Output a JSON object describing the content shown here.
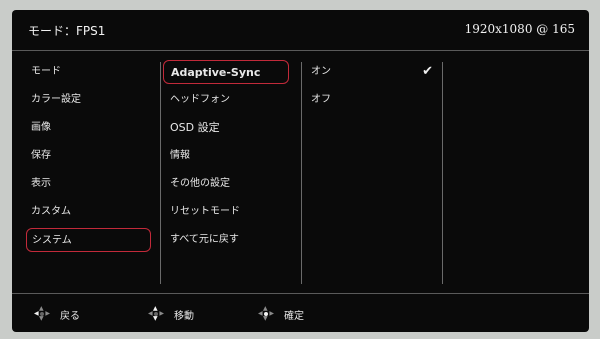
{
  "header": {
    "mode": "モード：FPS1",
    "resolution": "1920x1080 @ 165"
  },
  "main_menu": [
    {
      "label": "モード"
    },
    {
      "label": "カラー設定"
    },
    {
      "label": "画像"
    },
    {
      "label": "保存"
    },
    {
      "label": "表示"
    },
    {
      "label": "カスタム"
    },
    {
      "label": "システム",
      "selected": true
    }
  ],
  "sub_menu": [
    {
      "label": "Adaptive-Sync",
      "selected": true
    },
    {
      "label": "ヘッドフォン"
    },
    {
      "label": "OSD 設定"
    },
    {
      "label": "情報"
    },
    {
      "label": "その他の設定"
    },
    {
      "label": "リセットモード"
    },
    {
      "label": "すべて元に戻す"
    }
  ],
  "options": [
    {
      "label": "オン",
      "checked": true
    },
    {
      "label": "オフ",
      "checked": false
    }
  ],
  "footer": {
    "back_label": "戻る",
    "move_label": "移動",
    "confirm_label": "確定"
  },
  "colors": {
    "background": "#0a0a0a",
    "selection_border": "#c22a3a",
    "text": "#e8e8e8"
  },
  "icons": {
    "check": "checkmark-icon",
    "back": "dpad-left-icon",
    "move": "dpad-updown-icon",
    "confirm": "dpad-center-icon"
  }
}
